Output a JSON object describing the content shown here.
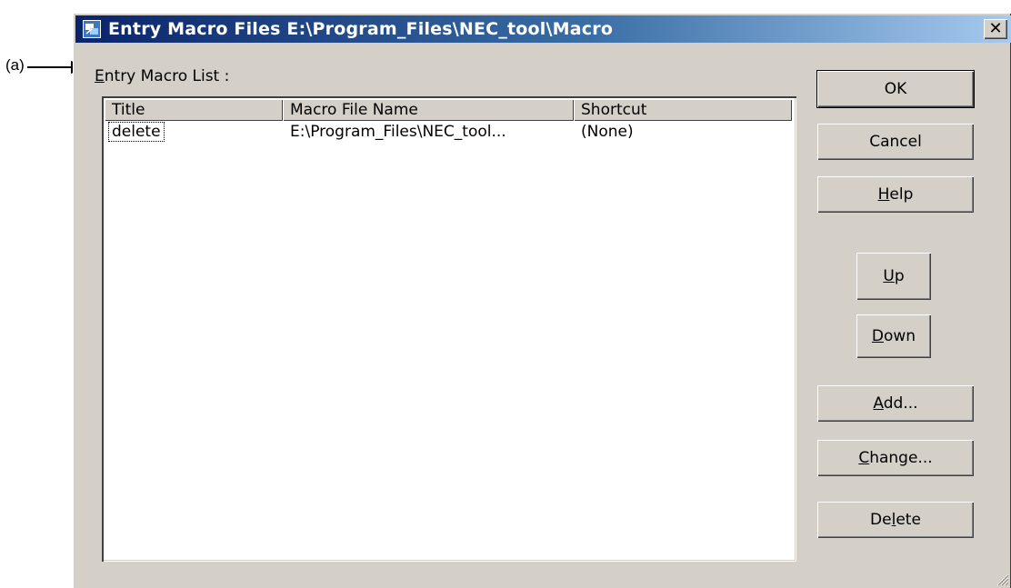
{
  "annotation": {
    "label": "(a)"
  },
  "window": {
    "title": "Entry Macro Files E:\\Program_Files\\NEC_tool\\Macro",
    "close_label": "✕"
  },
  "list": {
    "label_mnemonic": "E",
    "label_rest": "ntry Macro List :",
    "columns": [
      "Title",
      "Macro File Name",
      "Shortcut"
    ],
    "rows": [
      {
        "title": "delete",
        "file": "E:\\Program_Files\\NEC_tool...",
        "shortcut": "(None)"
      }
    ]
  },
  "buttons": {
    "ok": "OK",
    "cancel": "Cancel",
    "help": {
      "mn": "H",
      "rest": "elp"
    },
    "up": {
      "mn": "U",
      "rest": "p"
    },
    "down": {
      "mn": "D",
      "rest": "own"
    },
    "add": {
      "mn": "A",
      "rest": "dd..."
    },
    "change": {
      "mn": "C",
      "rest": "hange..."
    },
    "delete": {
      "pre": "De",
      "mn": "l",
      "rest": "ete"
    }
  }
}
